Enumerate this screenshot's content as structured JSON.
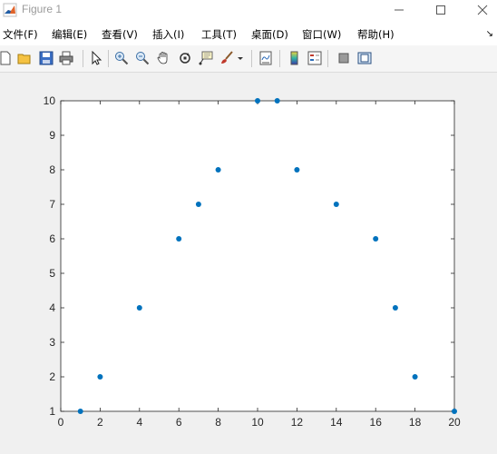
{
  "window": {
    "title": "Figure 1"
  },
  "menu": [
    "文件(F)",
    "编辑(E)",
    "查看(V)",
    "插入(I)",
    "工具(T)",
    "桌面(D)",
    "窗口(W)",
    "帮助(H)"
  ],
  "toolbar": {
    "icons": [
      "new-figure-icon",
      "open-file-icon",
      "save-icon",
      "print-icon",
      "select-pointer-icon",
      "zoom-in-icon",
      "zoom-out-icon",
      "pan-icon",
      "rotate-3d-icon",
      "data-cursor-icon",
      "brush-icon",
      "brush-dropdown-icon",
      "link-plot-icon",
      "insert-colorbar-icon",
      "insert-legend-icon",
      "hide-plot-tools-icon",
      "show-plot-tools-icon"
    ]
  },
  "colors": {
    "marker": "#0072bd",
    "axes_bg": "#ffffff",
    "figure_bg": "#f0f0f0"
  },
  "chart_data": {
    "type": "scatter",
    "x": [
      1,
      2,
      4,
      6,
      7,
      8,
      10,
      11,
      12,
      14,
      16,
      17,
      18,
      20
    ],
    "y": [
      1,
      2,
      4,
      6,
      7,
      8,
      10,
      10,
      8,
      7,
      6,
      4,
      2,
      1
    ],
    "xlim": [
      0,
      20
    ],
    "ylim": [
      1,
      10
    ],
    "xticks": [
      "0",
      "2",
      "4",
      "6",
      "8",
      "10",
      "12",
      "14",
      "16",
      "18",
      "20"
    ],
    "yticks": [
      "1",
      "2",
      "3",
      "4",
      "5",
      "6",
      "7",
      "8",
      "9",
      "10"
    ],
    "grid": false
  }
}
